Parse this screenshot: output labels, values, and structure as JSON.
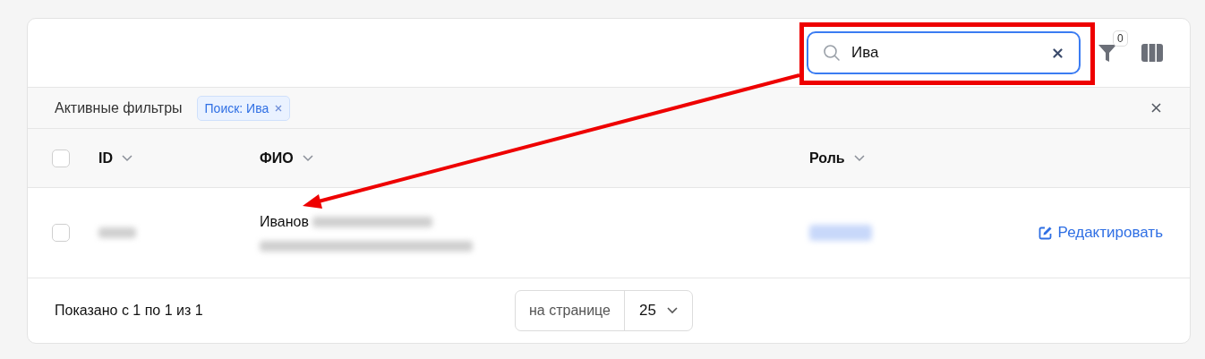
{
  "search": {
    "value": "Ива"
  },
  "filter_badge": "0",
  "active_filters": {
    "label": "Активные фильтры",
    "chips": [
      {
        "label": "Поиск: Ива"
      }
    ]
  },
  "table": {
    "select_all": {
      "checked": false
    },
    "columns": [
      {
        "label": "ID"
      },
      {
        "label": "ФИО"
      },
      {
        "label": "Роль"
      }
    ],
    "rows": [
      {
        "checked": false,
        "name": "Иванов",
        "action": "Редактировать"
      }
    ]
  },
  "footer": {
    "summary": "Показано с 1 по 1 из 1",
    "per_page_label": "на странице",
    "per_page": "25"
  }
}
